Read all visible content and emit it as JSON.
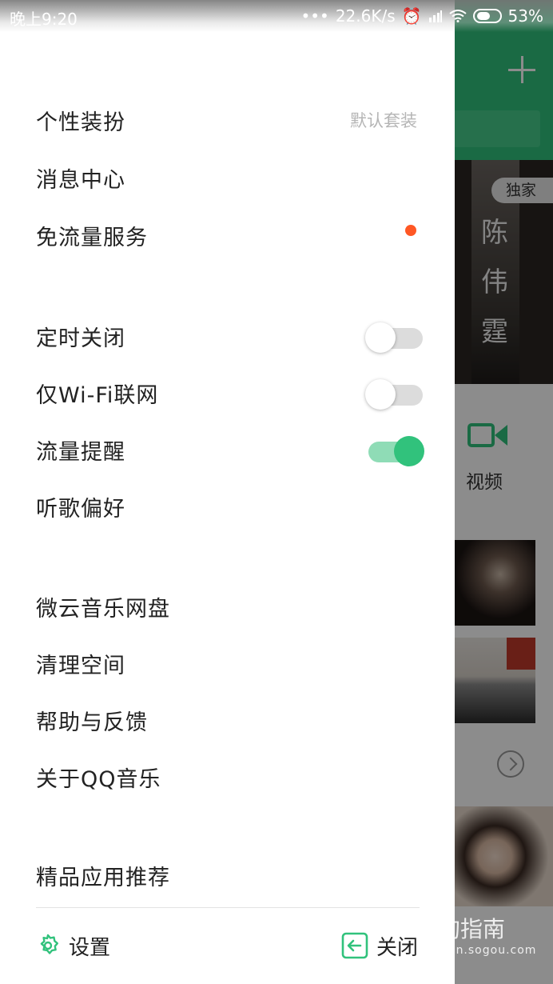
{
  "status_bar": {
    "time": "晚上9:20",
    "speed": "22.6K/s",
    "battery": "53%"
  },
  "drawer": {
    "section1": [
      {
        "label": "个性装扮",
        "value": "默认套装"
      },
      {
        "label": "消息中心"
      },
      {
        "label": "免流量服务",
        "has_dot": true
      }
    ],
    "section2": [
      {
        "label": "定时关闭",
        "toggle": false
      },
      {
        "label": "仅Wi-Fi联网",
        "toggle": false
      },
      {
        "label": "流量提醒",
        "toggle": true
      },
      {
        "label": "听歌偏好"
      }
    ],
    "section3": [
      {
        "label": "微云音乐网盘"
      },
      {
        "label": "清理空间"
      },
      {
        "label": "帮助与反馈"
      },
      {
        "label": "关于QQ音乐"
      }
    ],
    "section4": [
      {
        "label": "精品应用推荐"
      }
    ],
    "footer": {
      "settings_label": "设置",
      "close_label": "关闭"
    }
  },
  "background": {
    "badge": "独家",
    "banner_text": "陈 伟 霆",
    "video_label": "视频"
  },
  "watermark": {
    "main": "搜狗指南",
    "sub": "zhinan.sogou.com"
  },
  "colors": {
    "accent": "#31c27c",
    "dot": "#ff5724"
  }
}
